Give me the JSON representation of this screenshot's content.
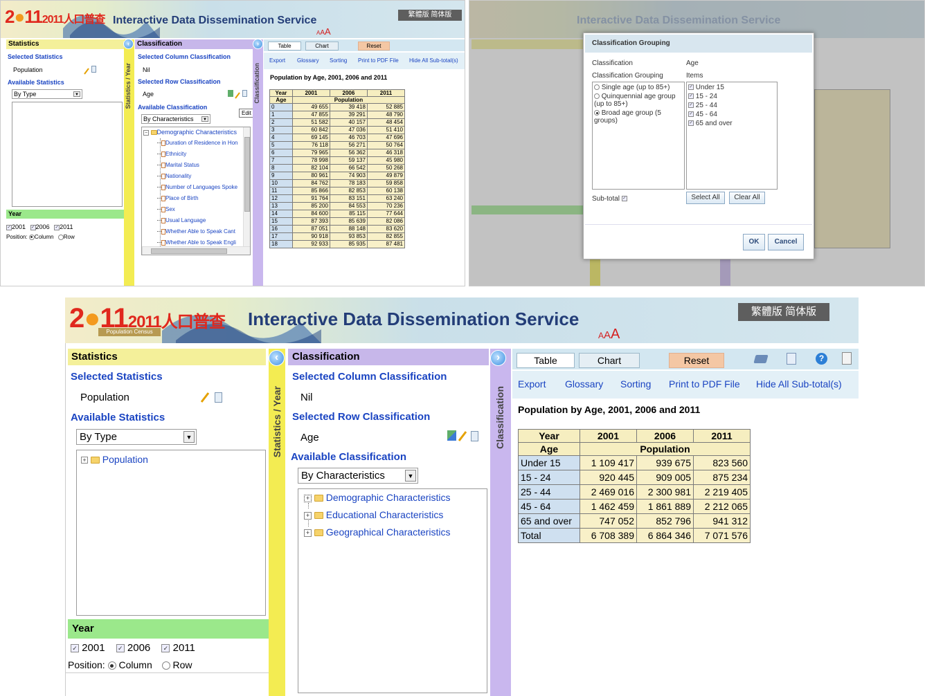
{
  "banner": {
    "logo_text": "2011人口普查",
    "logo_sub": "Population Census",
    "title": "Interactive Data Dissemination Service",
    "lang_trad": "繁體版",
    "lang_simp": "简体版",
    "font_small": "A",
    "font_mid": "A",
    "font_large": "A"
  },
  "tl": {
    "statistics_header": "Statistics",
    "selected_statistics": "Selected Statistics",
    "population": "Population",
    "available_statistics": "Available Statistics",
    "by_type": "By Type",
    "year_header": "Year",
    "year_2001": "2001",
    "year_2006": "2006",
    "year_2011": "2011",
    "position_label": "Position:",
    "column_label": "Column",
    "row_label": "Row",
    "strip_left": "Statistics / Year",
    "classification_header": "Classification",
    "selected_column": "Selected Column Classification",
    "nil": "Nil",
    "selected_row": "Selected Row Classification",
    "age": "Age",
    "edit_tooltip": "Edit",
    "available_classification": "Available Classification",
    "by_characteristics": "By Characteristics",
    "strip_right": "Classification",
    "tree_root": "Demographic Characteristics",
    "tree_items": [
      "Duration of Residence in Hon",
      "Ethnicity",
      "Marital Status",
      "Nationality",
      "Number of Languages Spoke",
      "Place of Birth",
      "Sex",
      "Usual Language",
      "Whether Able to Speak Cant",
      "Whether Able to Speak Engli"
    ],
    "tabs": [
      "Table",
      "Chart",
      "Reset"
    ],
    "links": [
      "Export",
      "Glossary",
      "Sorting",
      "Print to PDF File",
      "Hide All Sub-total(s)"
    ],
    "table_title": "Population by Age, 2001, 2006 and 2011",
    "table_year_label": "Year",
    "table_age_label": "Age",
    "table_pop_label": "Population",
    "table_years": [
      "2001",
      "2006",
      "2011"
    ],
    "table_rows": [
      [
        "0",
        "49 655",
        "39 418",
        "52 885"
      ],
      [
        "1",
        "47 855",
        "39 291",
        "48 790"
      ],
      [
        "2",
        "51 582",
        "40 157",
        "48 454"
      ],
      [
        "3",
        "60 842",
        "47 036",
        "51 410"
      ],
      [
        "4",
        "69 145",
        "46 703",
        "47 696"
      ],
      [
        "5",
        "76 118",
        "56 271",
        "50 764"
      ],
      [
        "6",
        "79 965",
        "56 362",
        "46 318"
      ],
      [
        "7",
        "78 998",
        "59 137",
        "45 980"
      ],
      [
        "8",
        "82 104",
        "66 542",
        "50 268"
      ],
      [
        "9",
        "80 961",
        "74 903",
        "49 879"
      ],
      [
        "10",
        "84 762",
        "78 183",
        "59 858"
      ],
      [
        "11",
        "85 866",
        "82 853",
        "60 138"
      ],
      [
        "12",
        "91 764",
        "83 151",
        "63 240"
      ],
      [
        "13",
        "85 200",
        "84 553",
        "70 236"
      ],
      [
        "14",
        "84 600",
        "85 115",
        "77 644"
      ],
      [
        "15",
        "87 393",
        "85 639",
        "82 086"
      ],
      [
        "16",
        "87 051",
        "88 148",
        "83 620"
      ],
      [
        "17",
        "90 918",
        "93 853",
        "82 855"
      ],
      [
        "18",
        "92 933",
        "85 935",
        "87 481"
      ]
    ]
  },
  "dialog": {
    "title": "Classification Grouping",
    "classification_label": "Classification",
    "classification_value": "Age",
    "grouping_label": "Classification Grouping",
    "items_label": "Items",
    "options": [
      "Single age (up to 85+)",
      "Quinquennial age group (up to 85+)",
      "Broad age group (5 groups)"
    ],
    "items": [
      "Under 15",
      "15 - 24",
      "25 - 44",
      "45 - 64",
      "65 and over"
    ],
    "subtotal_label": "Sub-total",
    "select_all": "Select All",
    "clear_all": "Clear All",
    "ok": "OK",
    "cancel": "Cancel"
  },
  "main": {
    "statistics_header": "Statistics",
    "selected_statistics": "Selected Statistics",
    "population": "Population",
    "available_statistics": "Available Statistics",
    "by_type": "By Type",
    "tree_population": "Population",
    "year_header": "Year",
    "year_2001": "2001",
    "year_2006": "2006",
    "year_2011": "2011",
    "position_label": "Position:",
    "column_label": "Column",
    "row_label": "Row",
    "strip_left": "Statistics / Year",
    "classification_header": "Classification",
    "selected_column": "Selected Column Classification",
    "nil": "Nil",
    "selected_row": "Selected Row Classification",
    "age": "Age",
    "available_classification": "Available Classification",
    "by_characteristics": "By Characteristics",
    "tree": [
      "Demographic Characteristics",
      "Educational Characteristics",
      "Geographical Characteristics"
    ],
    "strip_right": "Classification",
    "tabs": [
      "Table",
      "Chart",
      "Reset"
    ],
    "links": [
      "Export",
      "Glossary",
      "Sorting",
      "Print to PDF File",
      "Hide All Sub-total(s)"
    ],
    "table_title": "Population by Age, 2001, 2006 and 2011",
    "table_year_label": "Year",
    "table_age_label": "Age",
    "table_pop_label": "Population",
    "table_years": [
      "2001",
      "2006",
      "2011"
    ],
    "table_rows": [
      [
        "Under 15",
        "1 109 417",
        "939 675",
        "823 560"
      ],
      [
        "15 - 24",
        "920 445",
        "909 005",
        "875 234"
      ],
      [
        "25 - 44",
        "2 469 016",
        "2 300 981",
        "2 219 405"
      ],
      [
        "45 - 64",
        "1 462 459",
        "1 861 889",
        "2 212 065"
      ],
      [
        "65 and over",
        "747 052",
        "852 796",
        "941 312"
      ],
      [
        "Total",
        "6 708 389",
        "6 864 346",
        "7 071 576"
      ]
    ]
  },
  "colors": {
    "yellow_header": "#f4f09a",
    "purple_header": "#c7b7ea",
    "green_header": "#9be88b",
    "link_blue": "#1a44c2",
    "reset_tab": "#f4c7a4"
  },
  "icons": [
    "pencil-icon",
    "trash-icon",
    "arrow-left-icon",
    "arrow-right-icon",
    "printer-icon",
    "export-icon",
    "help-icon",
    "clipboard-icon",
    "folder-icon",
    "document-icon"
  ]
}
